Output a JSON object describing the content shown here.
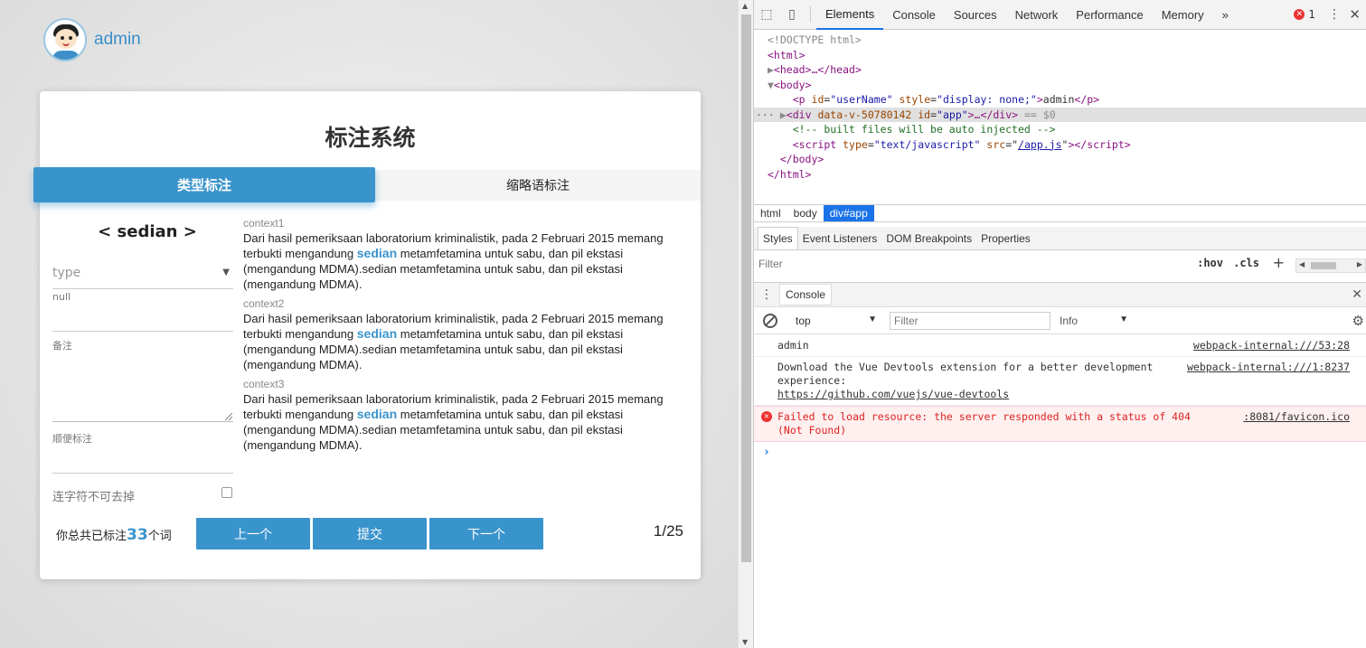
{
  "app": {
    "username": "admin",
    "title": "标注系统",
    "tabs": [
      {
        "label": "类型标注",
        "active": true
      },
      {
        "label": "缩略语标注",
        "active": false
      }
    ],
    "term": "< sedian >",
    "type_placeholder": "type",
    "type_value_hint": "null",
    "note_label": "备注",
    "extra_label": "顺便标注",
    "hyphen_checkbox_label": "连字符不可去掉",
    "contexts": [
      {
        "label": "context1",
        "before": "Dari hasil pemeriksaan laboratorium kriminalistik, pada 2 Februari 2015 memang terbukti mengandung ",
        "highlight": "sedian",
        "after": " metamfetamina untuk sabu, dan pil ekstasi (mengandung MDMA).sedian metamfetamina untuk sabu, dan pil ekstasi (mengandung MDMA)."
      },
      {
        "label": "context2",
        "before": "Dari hasil pemeriksaan laboratorium kriminalistik, pada 2 Februari 2015 memang terbukti mengandung ",
        "highlight": "sedian",
        "after": " metamfetamina untuk sabu, dan pil ekstasi (mengandung MDMA).sedian metamfetamina untuk sabu, dan pil ekstasi (mengandung MDMA)."
      },
      {
        "label": "context3",
        "before": "Dari hasil pemeriksaan laboratorium kriminalistik, pada 2 Februari 2015 memang terbukti mengandung ",
        "highlight": "sedian",
        "after": " metamfetamina untuk sabu, dan pil ekstasi (mengandung MDMA).sedian metamfetamina untuk sabu, dan pil ekstasi (mengandung MDMA)."
      }
    ],
    "total_prefix": "你总共已标注",
    "total_count": "33",
    "total_suffix": "个词",
    "buttons": {
      "prev": "上一个",
      "submit": "提交",
      "next": "下一个"
    },
    "page_indicator": "1/25",
    "accent_color": "#3a94cc"
  },
  "devtools": {
    "tabs": [
      "Elements",
      "Console",
      "Sources",
      "Network",
      "Performance",
      "Memory"
    ],
    "more_tabs": "»",
    "error_count": "1",
    "dom": {
      "doctype": "<!DOCTYPE html>",
      "html_open": "<html>",
      "head": "<head>…</head>",
      "body_open": "<body>",
      "p_tag": "p",
      "p_id_attr": "id",
      "p_id_val": "\"userName\"",
      "p_style_attr": "style",
      "p_style_val": "\"display: none;\"",
      "p_text": "admin",
      "div_tag": "div",
      "div_attr1": "data-v-50780142",
      "div_id_attr": "id",
      "div_id_val": "\"app\"",
      "div_tail": "…</div>",
      "div_eq": " == $0",
      "comment": "<!-- built files will be auto injected -->",
      "script_tag": "script",
      "script_type_attr": "type",
      "script_type_val": "\"text/javascript\"",
      "script_src_attr": "src",
      "script_src_val": "/app.js",
      "body_close": "</body>",
      "html_close": "</html>"
    },
    "breadcrumbs": [
      "html",
      "body",
      "div#app"
    ],
    "sub_tabs": [
      "Styles",
      "Event Listeners",
      "DOM Breakpoints",
      "Properties"
    ],
    "styles_filter_placeholder": "Filter",
    "hov": ":hov",
    "cls": ".cls",
    "drawer_tab": "Console",
    "console_context": "top",
    "console_filter_placeholder": "Filter",
    "console_level": "Info",
    "messages": [
      {
        "type": "log",
        "text": "admin",
        "source": "webpack-internal:///53:28"
      },
      {
        "type": "log",
        "text": "Download the Vue Devtools extension for a better development experience:",
        "link": "https://github.com/vuejs/vue-devtools",
        "source": "webpack-internal:///1:8237"
      },
      {
        "type": "error",
        "text": "Failed to load resource: the server responded with a status of 404 (Not Found)",
        "source": ":8081/favicon.ico"
      }
    ],
    "prompt": "›"
  }
}
